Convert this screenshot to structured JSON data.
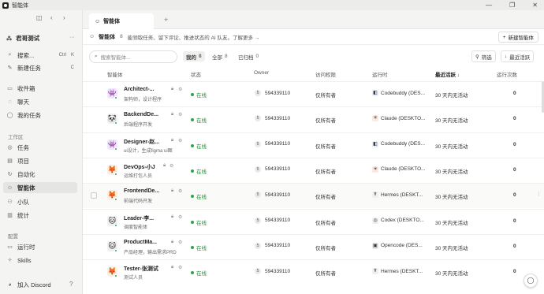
{
  "titlebar": {
    "title": "智能体",
    "minimize": "—",
    "maximize": "❐",
    "close": "✕"
  },
  "sidebar": {
    "workspace": "君哥测试",
    "workspace_menu": "···",
    "top_items": [
      {
        "label": "搜索...",
        "kbd1": "Ctrl",
        "kbd2": "K",
        "icon": "search-icon"
      },
      {
        "label": "新建任务",
        "kbd1": "C",
        "icon": "edit-icon"
      }
    ],
    "group1": [
      {
        "label": "收件箱",
        "icon": "inbox-icon"
      },
      {
        "label": "聊天",
        "icon": "chat-icon"
      },
      {
        "label": "我的任务",
        "icon": "user-task-icon"
      }
    ],
    "section_workspace": "工作区",
    "group2": [
      {
        "label": "任务",
        "icon": "task-icon"
      },
      {
        "label": "项目",
        "icon": "folder-icon"
      },
      {
        "label": "自动化",
        "icon": "automation-icon"
      },
      {
        "label": "智能体",
        "icon": "bot-icon",
        "active": true
      },
      {
        "label": "小队",
        "icon": "team-icon"
      },
      {
        "label": "统计",
        "icon": "chart-icon"
      }
    ],
    "section_config": "配置",
    "group3": [
      {
        "label": "运行时",
        "icon": "runtime-icon"
      },
      {
        "label": "Skills",
        "icon": "skills-icon"
      }
    ],
    "discord": "加入 Discord"
  },
  "tabs": [
    {
      "label": "智能体"
    }
  ],
  "info": {
    "title": "智能体",
    "count": "8",
    "desc": "能领取任务、留下评论、推进状态的 AI 队友。了解更多 →",
    "new_button": "新建智能体"
  },
  "filters": {
    "search_placeholder": "搜索智能体...",
    "tabs": [
      {
        "label": "我的",
        "count": "8",
        "active": true
      },
      {
        "label": "全部",
        "count": "8"
      },
      {
        "label": "已归档",
        "count": "0"
      }
    ],
    "filter_btn": "筛选",
    "sort_btn": "最近活跃"
  },
  "table": {
    "headers": {
      "agent": "智能体",
      "status": "状态",
      "owner": "Owner",
      "access": "访问权限",
      "runtime": "运行时",
      "last_active": "最近活跃 ↓",
      "runs": "运行次数"
    },
    "rows": [
      {
        "name": "Architect-...",
        "desc": "架构师，设计程序",
        "avatar": "👾",
        "avatar_bg": "#efe7fb",
        "status": "在线",
        "owner_initial": "5",
        "owner": "594339110",
        "access": "仅所有者",
        "runtime_icon": "◧",
        "runtime_bg": "#e8eef8",
        "runtime": "Codebuddy (DES...",
        "last_active": "30 天内无活动",
        "runs": "0"
      },
      {
        "name": "BackendDe...",
        "desc": "后端程序开发",
        "avatar": "🐼",
        "avatar_bg": "#f0f0f0",
        "status": "在线",
        "owner_initial": "5",
        "owner": "594339110",
        "access": "仅所有者",
        "runtime_icon": "✳",
        "runtime_bg": "#fbe9e2",
        "runtime": "Claude (DESKTO...",
        "last_active": "30 天内无活动",
        "runs": "0"
      },
      {
        "name": "Designer-赵...",
        "desc": "ui设计，生成figma ui图",
        "avatar": "👾",
        "avatar_bg": "#efe7fb",
        "status": "在线",
        "owner_initial": "5",
        "owner": "594339110",
        "access": "仅所有者",
        "runtime_icon": "◧",
        "runtime_bg": "#e8eef8",
        "runtime": "Codebuddy (DES...",
        "last_active": "30 天内无活动",
        "runs": "0"
      },
      {
        "name": "DevOps-小J",
        "desc": "运维打包人员",
        "avatar": "🦊",
        "avatar_bg": "#fdeee3",
        "status": "在线",
        "owner_initial": "5",
        "owner": "594339110",
        "access": "仅所有者",
        "runtime_icon": "✳",
        "runtime_bg": "#fbe9e2",
        "runtime": "Claude (DESKTO...",
        "last_active": "30 天内无活动",
        "runs": "0"
      },
      {
        "name": "FrontendDe...",
        "desc": "前端代码开发",
        "avatar": "🦊",
        "avatar_bg": "#fdeee3",
        "status": "在线",
        "owner_initial": "5",
        "owner": "594339110",
        "access": "仅所有者",
        "runtime_icon": "☤",
        "runtime_bg": "#f0f0f0",
        "runtime": "Hermes (DESKT...",
        "last_active": "30 天内无活动",
        "runs": "0"
      },
      {
        "name": "Leader-李...",
        "desc": "调度智能体",
        "avatar": "🐱",
        "avatar_bg": "#f0f0f0",
        "status": "在线",
        "owner_initial": "5",
        "owner": "594339110",
        "access": "仅所有者",
        "runtime_icon": "◎",
        "runtime_bg": "#f0f0f0",
        "runtime": "Codex (DESKTO...",
        "last_active": "30 天内无活动",
        "runs": "0"
      },
      {
        "name": "ProductMa...",
        "desc": "产品经理，输出需求PRD",
        "avatar": "🐱",
        "avatar_bg": "#f0f0f0",
        "status": "在线",
        "owner_initial": "5",
        "owner": "594339110",
        "access": "仅所有者",
        "runtime_icon": "▣",
        "runtime_bg": "#e6e6e6",
        "runtime": "Opencode (DES...",
        "last_active": "30 天内无活动",
        "runs": "0"
      },
      {
        "name": "Tester-张测试",
        "desc": "测试人员",
        "avatar": "🦊",
        "avatar_bg": "#fdeee3",
        "status": "在线",
        "owner_initial": "5",
        "owner": "594339110",
        "access": "仅所有者",
        "runtime_icon": "☤",
        "runtime_bg": "#f0f0f0",
        "runtime": "Hermes (DESKT...",
        "last_active": "30 天内无活动",
        "runs": "0"
      }
    ]
  },
  "colors": {
    "online": "#2ea44f",
    "accent": "#222222"
  }
}
